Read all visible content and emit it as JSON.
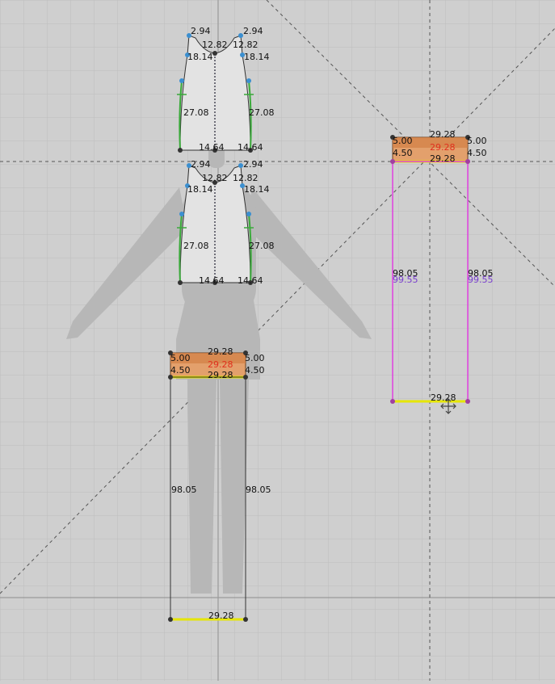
{
  "viewport": {
    "title": "2D Pattern Window",
    "grid": true,
    "background": "#cfcfcf",
    "grid_color": "#bdbdbd",
    "avatar_color": "#b7b7b7"
  },
  "colors": {
    "piece_fill": "#e3e3e3",
    "seam_green": "#3aaa3a",
    "waistband_orange": "#e3a06c",
    "waistband_dark": "#d27f45",
    "pink_outline": "#e040e0",
    "yellow_edge": "#e6e600",
    "point_blue": "#3b8fd0",
    "measure_red": "#e0301e",
    "measure_purple": "#7a3fd0"
  },
  "pieces": {
    "front_bodice": {
      "top_left": "2.94",
      "top_right": "2.94",
      "neck_left": "12.82",
      "neck_right": "12.82",
      "shoulder_left": "18.14",
      "shoulder_right": "18.14",
      "side_left": "27.08",
      "side_right": "27.08",
      "hem_left": "14.64",
      "hem_right": "14.64"
    },
    "back_bodice": {
      "top_left": "2.94",
      "top_right": "2.94",
      "neck_left": "12.82",
      "neck_right": "12.82",
      "shoulder_left": "18.14",
      "shoulder_right": "18.14",
      "side_left": "27.08",
      "side_right": "27.08",
      "hem_left": "14.64",
      "hem_right": "14.64"
    },
    "skirt_left": {
      "top_width": "29.28",
      "band_red": "29.28",
      "band_bottom": "29.28",
      "band_left_top": "5.00",
      "band_left_bottom": "4.50",
      "band_right_top": "5.00",
      "band_right_bottom": "4.50",
      "side_left": "98.05",
      "side_right": "98.05",
      "hem": "29.28"
    },
    "skirt_right": {
      "top_width": "29.28",
      "band_red": "29.28",
      "band_bottom": "29.28",
      "band_left_top": "5.00",
      "band_left_bottom": "4.50",
      "band_right_top": "5.00",
      "band_right_bottom": "4.50",
      "side_left": "98.05",
      "side_left_purple": "99.55",
      "side_right": "98.05",
      "side_right_purple": "99.55",
      "hem": "29.28"
    }
  }
}
